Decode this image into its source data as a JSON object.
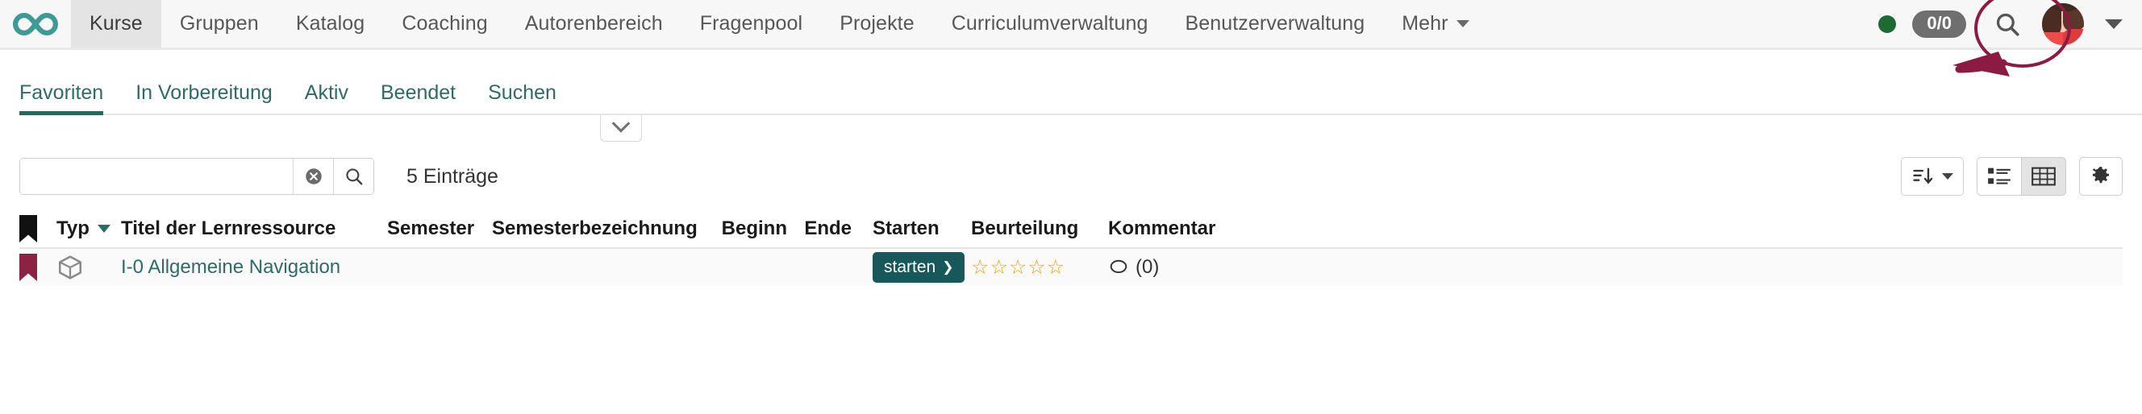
{
  "brand": {
    "logo_icon": "infinity-logo",
    "color": "#3f9a96"
  },
  "nav": {
    "items": [
      {
        "label": "Kurse",
        "active": true
      },
      {
        "label": "Gruppen",
        "active": false
      },
      {
        "label": "Katalog",
        "active": false
      },
      {
        "label": "Coaching",
        "active": false
      },
      {
        "label": "Autorenbereich",
        "active": false
      },
      {
        "label": "Fragenpool",
        "active": false
      },
      {
        "label": "Projekte",
        "active": false
      },
      {
        "label": "Curriculumverwaltung",
        "active": false
      },
      {
        "label": "Benutzerverwaltung",
        "active": false
      },
      {
        "label": "Mehr",
        "active": false,
        "has_caret": true
      }
    ],
    "status_dot_color": "#1d6b33",
    "assessment_badge": "0/0",
    "search_icon": "search-icon",
    "avatar_icon": "user-avatar",
    "avatar_caret_icon": "chevron-down-icon"
  },
  "annotation": {
    "ellipse_color": "#8c1b43",
    "arrow_color": "#8c1b43",
    "target": "user-avatar"
  },
  "tabs": [
    {
      "label": "Favoriten",
      "active": true
    },
    {
      "label": "In Vorbereitung",
      "active": false
    },
    {
      "label": "Aktiv",
      "active": false
    },
    {
      "label": "Beendet",
      "active": false
    },
    {
      "label": "Suchen",
      "active": false
    }
  ],
  "collapse": {
    "icon": "chevron-down-icon"
  },
  "toolbar": {
    "search_value": "",
    "search_placeholder": "",
    "clear_icon": "clear-circle-icon",
    "search_icon": "search-icon",
    "entries_count": "5 Einträge",
    "sort_button_icon": "sort-descending-icon",
    "list_view_icon": "list-view-icon",
    "table_view_icon": "table-view-icon",
    "settings_icon": "gear-icon"
  },
  "table": {
    "columns": [
      "",
      "Typ",
      "Titel der Lernressource",
      "Semester",
      "Semesterbezeichnung",
      "Beginn",
      "Ende",
      "Starten",
      "Beurteilung",
      "Kommentar"
    ],
    "sorted_column": "Typ",
    "rows": [
      {
        "flag": true,
        "type_icon": "course-cube-icon",
        "title": "I-0 Allgemeine Navigation",
        "semester": "",
        "semester_label": "",
        "begin": "",
        "end": "",
        "start_label": "starten",
        "rating": 5,
        "comments": "(0)"
      }
    ]
  }
}
